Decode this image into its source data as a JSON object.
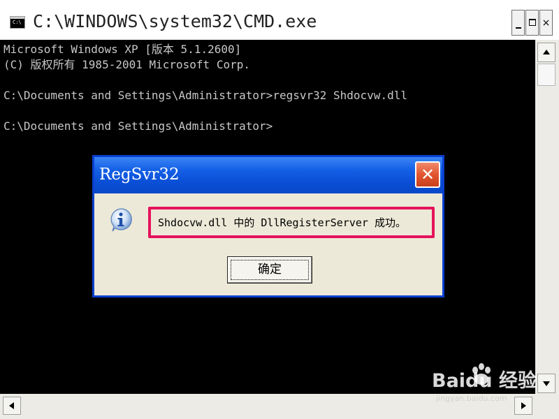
{
  "window": {
    "title": "C:\\WINDOWS\\system32\\CMD.exe",
    "icon_text": "C:\\",
    "minimize_glyph": "",
    "close_glyph": "×"
  },
  "console": {
    "lines": [
      "Microsoft Windows XP [版本 5.1.2600]",
      "(C) 版权所有 1985-2001 Microsoft Corp.",
      "C:\\Documents and Settings\\Administrator>regsvr32 Shdocvw.dll",
      "C:\\Documents and Settings\\Administrator>"
    ],
    "background_color": "#000000",
    "text_color": "#c8c8c8"
  },
  "dialog": {
    "title": "RegSvr32",
    "close_glyph": "✕",
    "icon": "information-icon",
    "message": "Shdocvw.dll 中的 DllRegisterServer 成功。",
    "ok_label": "确定",
    "highlight_color": "#e5135b",
    "title_color": "#0a4fd6"
  },
  "watermark": {
    "text": "Baidu 经验",
    "url": "jingyan.baidu.com"
  },
  "icons": {
    "scroll_up": "triangle-up-icon",
    "scroll_down": "triangle-down-icon",
    "scroll_left": "triangle-left-icon",
    "scroll_right": "triangle-right-icon"
  }
}
